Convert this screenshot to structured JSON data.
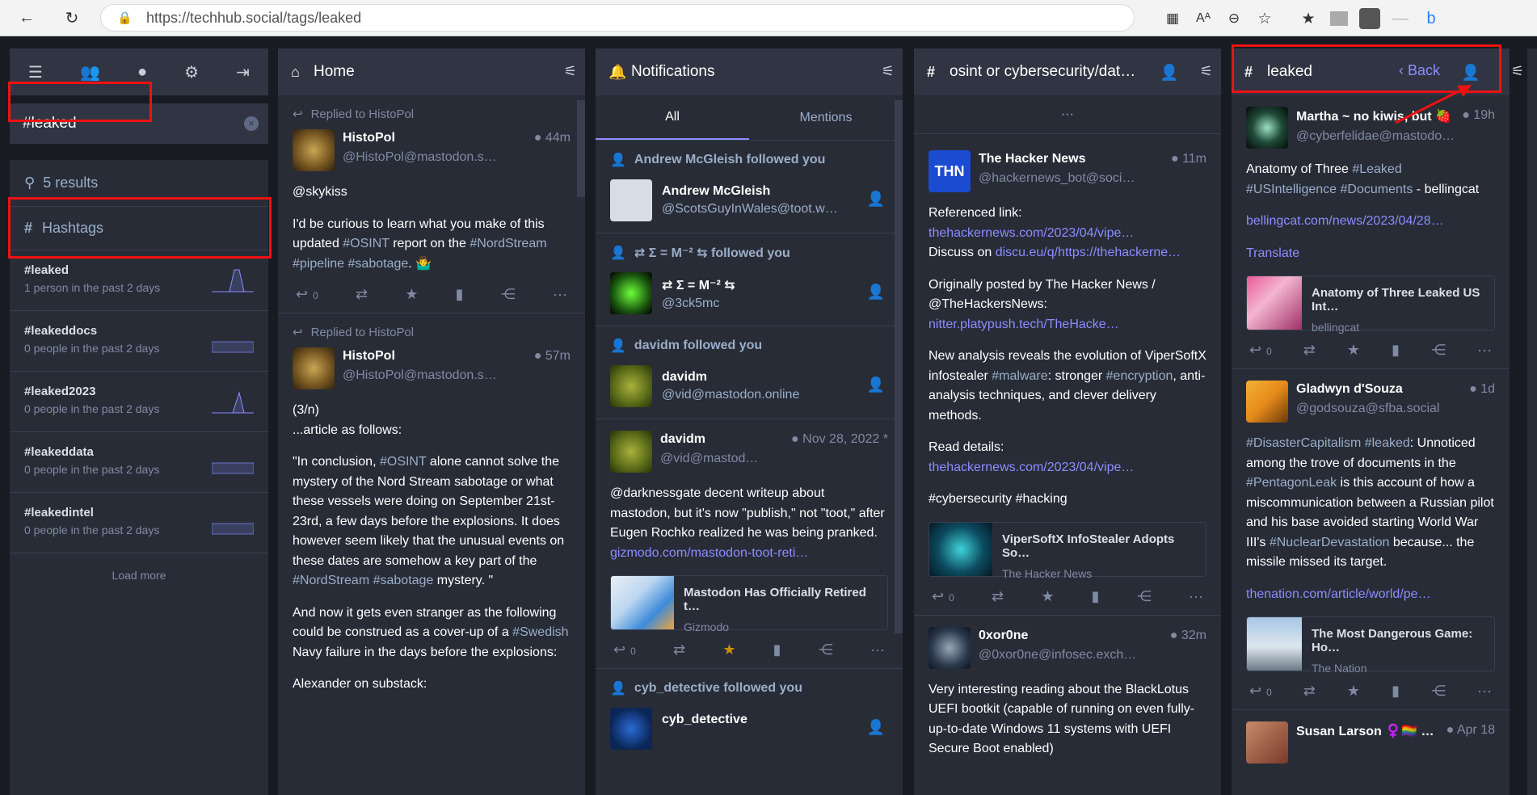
{
  "browser": {
    "url": "https://techhub.social/tags/leaked"
  },
  "search": {
    "value": "#leaked",
    "results": "5 results",
    "hashtags_heading": "Hashtags",
    "load_more": "Load more"
  },
  "hashtags": [
    {
      "name": "#leaked",
      "stat": "1 person in the past 2 days"
    },
    {
      "name": "#leakeddocs",
      "stat": "0 people in the past 2 days"
    },
    {
      "name": "#leaked2023",
      "stat": "0 people in the past 2 days"
    },
    {
      "name": "#leakeddata",
      "stat": "0 people in the past 2 days"
    },
    {
      "name": "#leakedintel",
      "stat": "0 people in the past 2 days"
    }
  ],
  "home": {
    "title": "Home",
    "posts": [
      {
        "prepend": "Replied to HistoPol",
        "name": "HistoPol",
        "acct": "@HistoPol@mastodon.s…",
        "time": "44m",
        "p1": "@skykiss",
        "p2a": "I'd be curious to learn what you make of this updated ",
        "p2h1": "#OSINT",
        "p2b": " report on the ",
        "p2h2": "#NordStream",
        "p2c": " ",
        "p2h3": "#pipeline",
        "p2d": " ",
        "p2h4": "#sabotage",
        "p2e": ". 🤷‍♂️",
        "replies": "0"
      },
      {
        "prepend": "Replied to HistoPol",
        "name": "HistoPol",
        "acct": "@HistoPol@mastodon.s…",
        "time": "57m",
        "p1a": "(3/n)",
        "p1b": "...article as follows:",
        "p2a": "\"In conclusion, ",
        "p2h1": "#OSINT",
        "p2b": " alone cannot solve the mystery of the Nord Stream sabotage or what these vessels were doing on September 21st-23rd, a few days before the explosions. It does however seem likely that the unusual events on these dates are somehow a key part of the ",
        "p2h2": "#NordStream",
        "p2c": " ",
        "p2h3": "#sabotage",
        "p2d": " mystery. \"",
        "p3a": "And now it gets even stranger as the following could be construed as a cover-up of a ",
        "p3h": "#Swedish",
        "p3b": " Navy failure in the days before the explosions:",
        "p4": "Alexander on substack:"
      }
    ]
  },
  "notifications": {
    "title": "Notifications",
    "tabs": [
      "All",
      "Mentions"
    ],
    "items": [
      {
        "title": "Andrew McGleish followed you",
        "name": "Andrew McGleish",
        "acct": "@ScotsGuyInWales@toot.w…"
      },
      {
        "title": "⇄ Σ = M⁻² ⇆ followed you",
        "name": "⇄ Σ = M⁻² ⇆",
        "acct": "@3ck5mc"
      },
      {
        "title": "davidm followed you",
        "name": "davidm",
        "acct": "@vid@mastodon.online"
      }
    ],
    "post": {
      "name": "davidm",
      "acct": "@vid@mastod…",
      "time": "Nov 28, 2022 *",
      "text_a": "@darknessgate decent writeup about mastodon, but it's now \"publish,\" not \"toot,\" after Eugen Rochko realized he was being pranked. ",
      "link": "gizmodo.com/mastodon-toot-reti…",
      "card_title": "Mastodon Has Officially Retired t…",
      "card_provider": "Gizmodo",
      "replies": "0"
    },
    "last_title": "cyb_detective followed you",
    "last_name": "cyb_detective"
  },
  "osint": {
    "title": "osint or cybersecurity/dat…",
    "more": "···",
    "post1": {
      "name": "The Hacker News",
      "acct": "@hackernews_bot@soci…",
      "time": "11m",
      "l1": "Referenced link:",
      "link1": "thehackernews.com/2023/04/vipe…",
      "l2": "Discuss on ",
      "link2": "discu.eu/q/https://thehackerne…",
      "p2": "Originally posted by The Hacker News / @TheHackersNews:",
      "link3": "nitter.platypush.tech/TheHacke…",
      "p3a": "New analysis reveals the evolution of ViperSoftX infostealer ",
      "p3h1": "#malware",
      "p3b": ": stronger ",
      "p3h2": "#encryption",
      "p3c": ", anti-analysis techniques, and clever delivery methods.",
      "p4": "Read details:",
      "link4": "thehackernews.com/2023/04/vipe…",
      "p5": "#cybersecurity #hacking",
      "card_title": "ViperSoftX InfoStealer Adopts So…",
      "card_provider": "The Hacker News",
      "replies": "0"
    },
    "post2": {
      "name": "0xor0ne",
      "acct": "@0xor0ne@infosec.exch…",
      "time": "32m",
      "text": "Very interesting reading about the BlackLotus UEFI bootkit (capable of running on even fully-up-to-date Windows 11 systems with UEFI Secure Boot enabled)"
    }
  },
  "leaked": {
    "title": "leaked",
    "back": "Back",
    "post1": {
      "name": "Martha ~ no kiwis, but 🍓",
      "acct": "@cyberfelidae@mastodo…",
      "time": "19h",
      "text_a": "Anatomy of Three ",
      "h1": "#Leaked",
      "text_b": " ",
      "h2": "#USIntelligence",
      "text_c": " ",
      "h3": "#Documents",
      "text_d": " - bellingcat",
      "link": "bellingcat.com/news/2023/04/28…",
      "translate": "Translate",
      "card_title": "Anatomy of Three Leaked US Int…",
      "card_provider": "bellingcat",
      "replies": "0"
    },
    "post2": {
      "name": "Gladwyn d'Souza",
      "acct": "@godsouza@sfba.social",
      "time": "1d",
      "h1": "#DisasterCapitalism",
      "t1": " ",
      "h2": "#leaked",
      "t2": ": Unnoticed among the trove of documents in the ",
      "h3": "#PentagonLeak",
      "t3": " is this account of how a miscommunication between a Russian pilot and his base avoided starting World War III's ",
      "h4": "#NuclearDevastation",
      "t4": " because... the missile missed its target.",
      "link": "thenation.com/article/world/pe…",
      "card_title": "The Most Dangerous Game: Ho…",
      "card_provider": "The Nation",
      "replies": "0"
    },
    "post3": {
      "name": "Susan Larson ♀️🏳️‍🌈 …",
      "time": "Apr 18"
    }
  }
}
